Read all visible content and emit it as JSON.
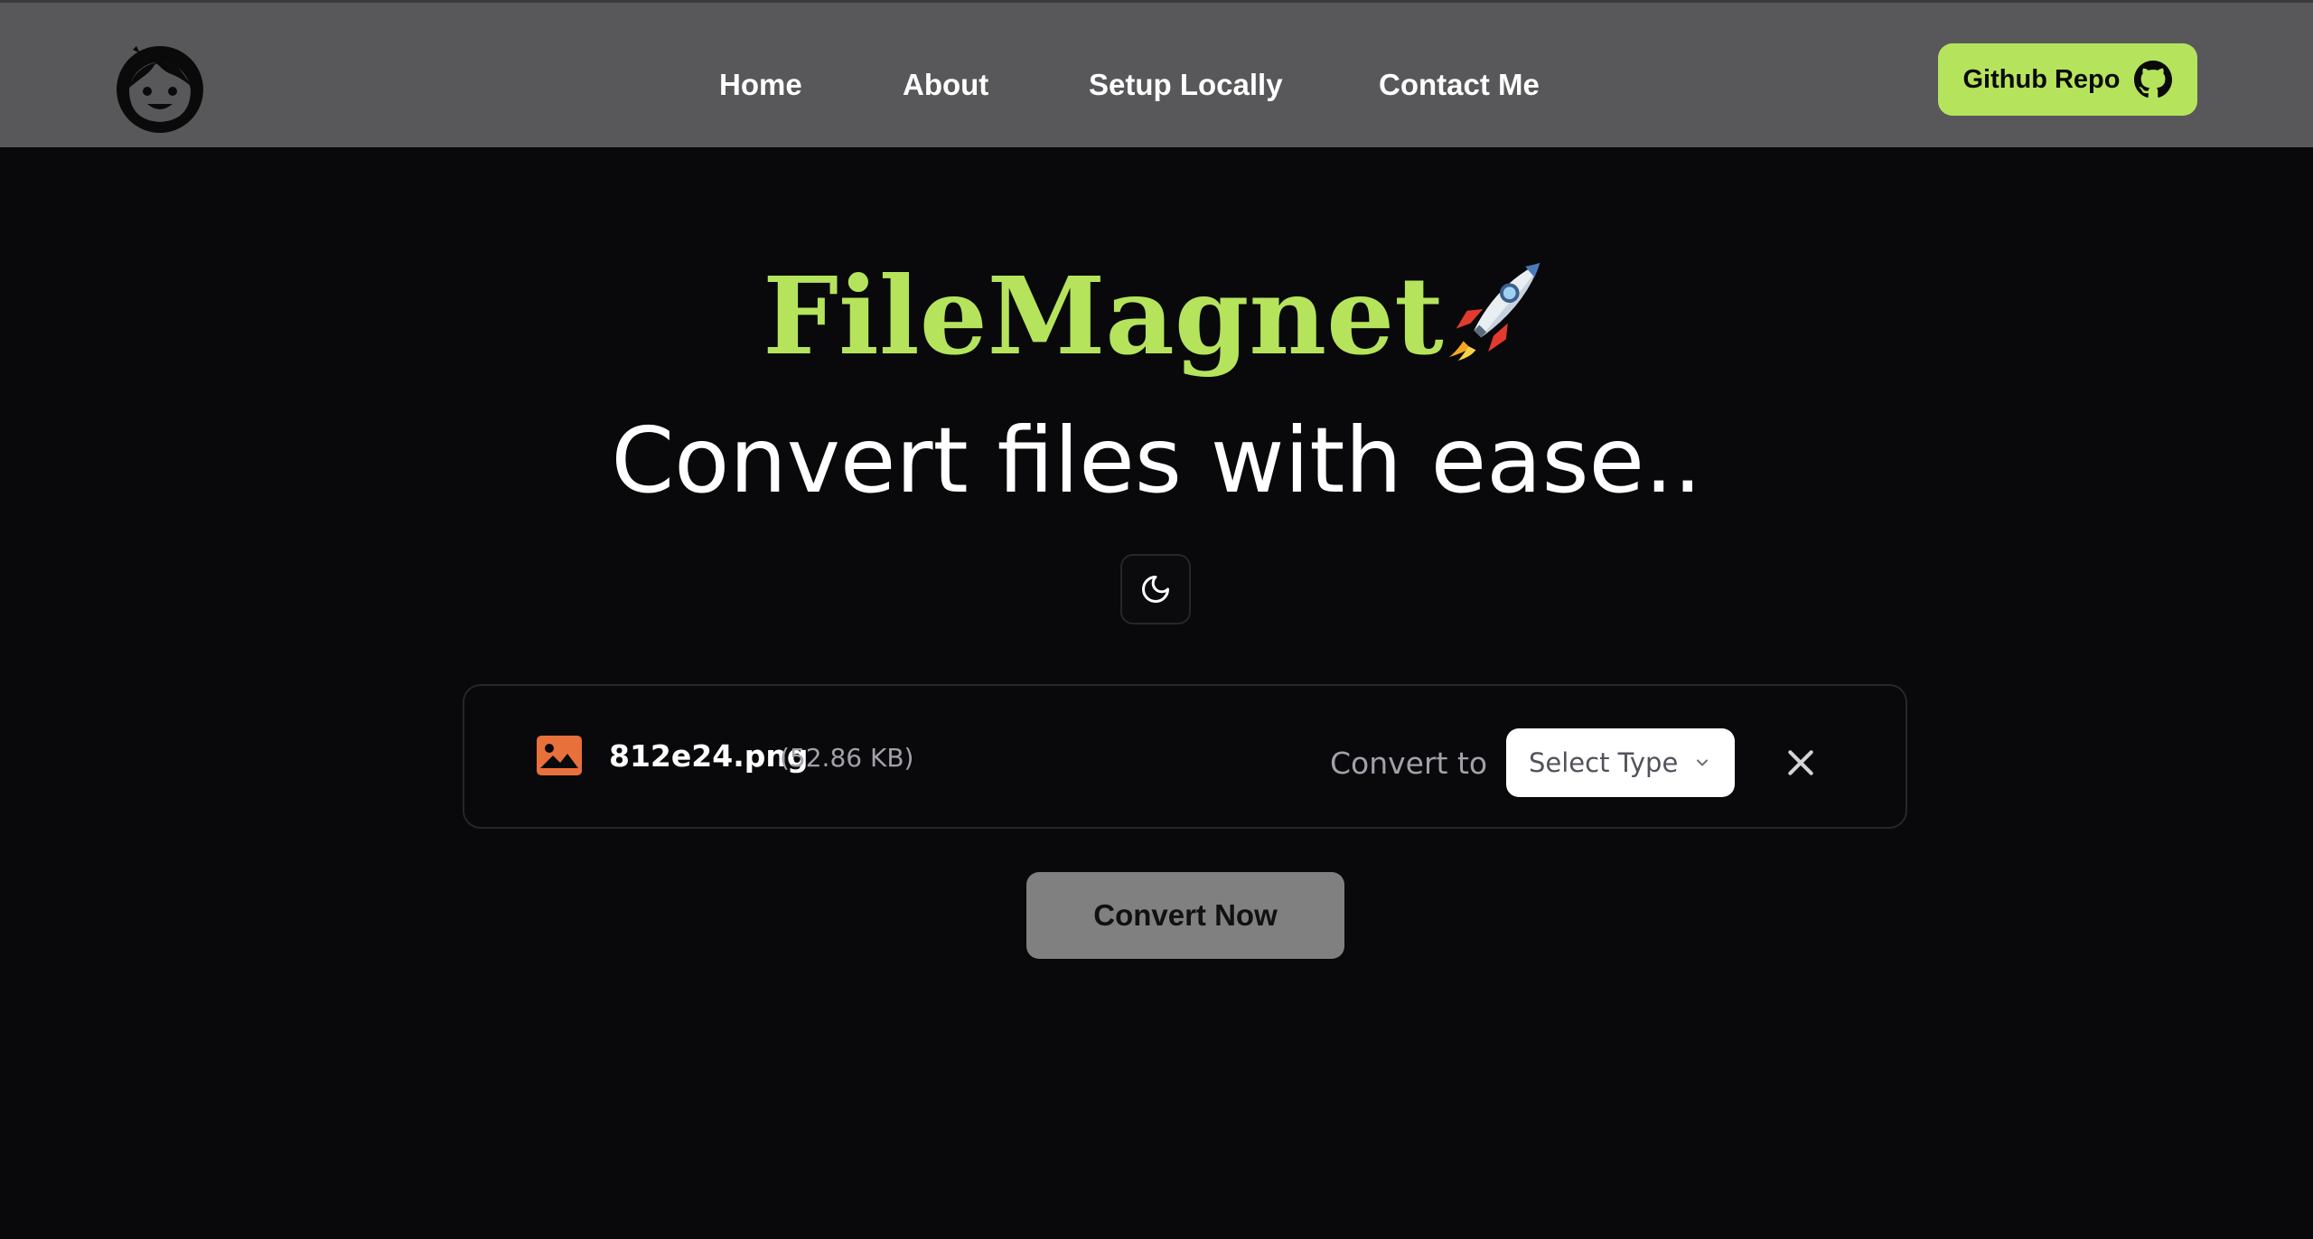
{
  "header": {
    "nav": [
      {
        "label": "Home"
      },
      {
        "label": "About"
      },
      {
        "label": "Setup Locally"
      },
      {
        "label": "Contact Me"
      }
    ],
    "github_label": "Github Repo"
  },
  "hero": {
    "brand": "FileMagnet",
    "tagline": "Convert files with ease.."
  },
  "file": {
    "name": "812e24.png",
    "size": "(52.86 KB)",
    "convert_to_label": "Convert to",
    "select_placeholder": "Select Type"
  },
  "actions": {
    "convert_label": "Convert Now"
  },
  "colors": {
    "header_bg": "#58585a",
    "accent": "#b5e45c",
    "page_bg": "#09090b",
    "file_icon": "#e8703a",
    "convert_button": "#808080"
  },
  "icons": {
    "logo": "face-logo-icon",
    "github": "github-icon",
    "theme": "moon-icon",
    "file": "image-file-icon",
    "select": "chevron-down-icon",
    "remove": "close-icon",
    "brand": "rocket-icon"
  }
}
